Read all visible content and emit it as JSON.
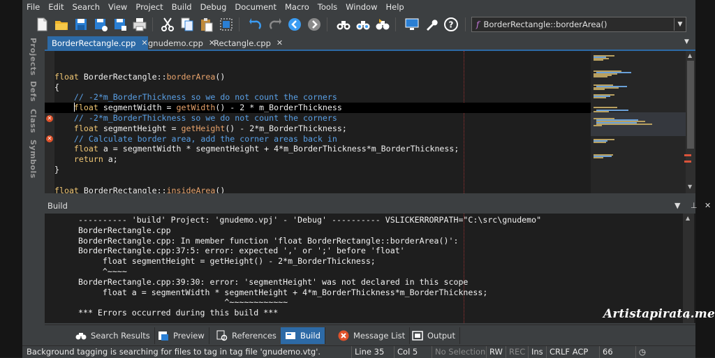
{
  "menu": [
    "File",
    "Edit",
    "Search",
    "View",
    "Project",
    "Build",
    "Debug",
    "Document",
    "Macro",
    "Tools",
    "Window",
    "Help"
  ],
  "toolbar": {
    "function_selector": "BorderRectangle::borderArea()",
    "function_icon": "f",
    "icons": [
      "new-file-icon",
      "open-folder-icon",
      "save-icon",
      "save-as-icon",
      "save-all-icon",
      "print-icon",
      "cut-icon",
      "copy-icon",
      "paste-icon",
      "select-all-icon",
      "undo-icon",
      "redo-icon",
      "back-icon",
      "forward-icon",
      "find-icon",
      "find-in-files-icon",
      "find-next-icon",
      "monitor-icon",
      "wrench-icon",
      "help-icon"
    ]
  },
  "side_tabs": [
    "Projects",
    "Defs",
    "Class",
    "Symbols"
  ],
  "doc_tabs": [
    {
      "label": "BorderRectangle.cpp",
      "active": true
    },
    {
      "label": "gnudemo.cpp",
      "active": false
    },
    {
      "label": "Rectangle.cpp",
      "active": false
    }
  ],
  "editor": {
    "lines": [
      {
        "parts": []
      },
      {
        "parts": [
          {
            "c": "kw",
            "t": "float "
          },
          {
            "c": "tx",
            "t": "BorderRectangle::"
          },
          {
            "c": "fn",
            "t": "borderArea"
          },
          {
            "c": "tx",
            "t": "()"
          }
        ]
      },
      {
        "parts": [
          {
            "c": "tx",
            "t": "{"
          }
        ]
      },
      {
        "parts": [
          {
            "c": "cm",
            "t": "    // -2*m_BorderThickness so we do not count the corners"
          }
        ]
      },
      {
        "cursor": true,
        "parts": [
          {
            "c": "tx",
            "t": "    "
          },
          {
            "c": "caret",
            "t": ""
          },
          {
            "c": "kw",
            "t": "float "
          },
          {
            "c": "tx",
            "t": "segmentWidth = "
          },
          {
            "c": "fn",
            "t": "getWidth"
          },
          {
            "c": "tx",
            "t": "() - 2 * m_BorderThickness"
          }
        ]
      },
      {
        "parts": [
          {
            "c": "cm",
            "t": "    // -2*m_BorderThickness so we do not count the corners"
          }
        ]
      },
      {
        "error": true,
        "parts": [
          {
            "c": "tx",
            "t": "    "
          },
          {
            "c": "kw",
            "t": "float "
          },
          {
            "c": "tx",
            "t": "segmentHeight = "
          },
          {
            "c": "fn",
            "t": "getHeight"
          },
          {
            "c": "tx",
            "t": "() - 2*m_BorderThickness;"
          }
        ]
      },
      {
        "parts": [
          {
            "c": "cm",
            "t": "    // Calculate border area, add the corner areas back in"
          }
        ]
      },
      {
        "error": true,
        "parts": [
          {
            "c": "tx",
            "t": "    "
          },
          {
            "c": "kw",
            "t": "float "
          },
          {
            "c": "tx",
            "t": "a = segmentWidth * segmentHeight + 4*m_BorderThickness*m_BorderThickness;"
          }
        ]
      },
      {
        "parts": [
          {
            "c": "tx",
            "t": "    "
          },
          {
            "c": "kw",
            "t": "return "
          },
          {
            "c": "tx",
            "t": "a;"
          }
        ]
      },
      {
        "parts": [
          {
            "c": "tx",
            "t": "}"
          }
        ]
      },
      {
        "parts": []
      },
      {
        "parts": [
          {
            "c": "kw",
            "t": "float "
          },
          {
            "c": "tx",
            "t": "BorderRectangle::"
          },
          {
            "c": "fn",
            "t": "insideArea"
          },
          {
            "c": "tx",
            "t": "()"
          }
        ]
      },
      {
        "parts": [
          {
            "c": "tx",
            "t": "{"
          }
        ]
      }
    ]
  },
  "build": {
    "title": "Build",
    "lines": [
      "---------- 'build' Project: 'gnudemo.vpj' - 'Debug' ---------- VSLICKERRORPATH=\"C:\\src\\gnudemo\"",
      "BorderRectangle.cpp",
      "BorderRectangle.cpp: In member function 'float BorderRectangle::borderArea()':",
      "BorderRectangle.cpp:37:5: error: expected ',' or ';' before 'float'",
      "     float segmentHeight = getHeight() - 2*m_BorderThickness;",
      "     ^~~~~",
      "BorderRectangle.cpp:39:30: error: 'segmentHeight' was not declared in this scope",
      "     float a = segmentWidth * segmentHeight + 4*m_BorderThickness*m_BorderThickness;",
      "                              ^~~~~~~~~~~~~",
      "*** Errors occurred during this build ***"
    ]
  },
  "watermark": "Artistapirata.me",
  "bottom_tabs": [
    {
      "label": "Search Results",
      "icon": "binoculars-icon",
      "active": false
    },
    {
      "label": "Preview",
      "icon": "preview-icon",
      "active": false
    },
    {
      "label": "References",
      "icon": "references-icon",
      "active": false
    },
    {
      "label": "Build",
      "icon": "build-icon",
      "active": true
    },
    {
      "label": "Message List",
      "icon": "error-icon",
      "active": false
    },
    {
      "label": "Output",
      "icon": "output-icon",
      "active": false
    }
  ],
  "status": {
    "message": "Background tagging is searching for files to tag in tag file 'gnudemo.vtg'.",
    "line": "Line 35",
    "col": "Col 5",
    "selection": "No Selection",
    "rw": "RW",
    "rec": "REC",
    "ins": "Ins",
    "encoding": "CRLF ACP",
    "number": "66"
  }
}
